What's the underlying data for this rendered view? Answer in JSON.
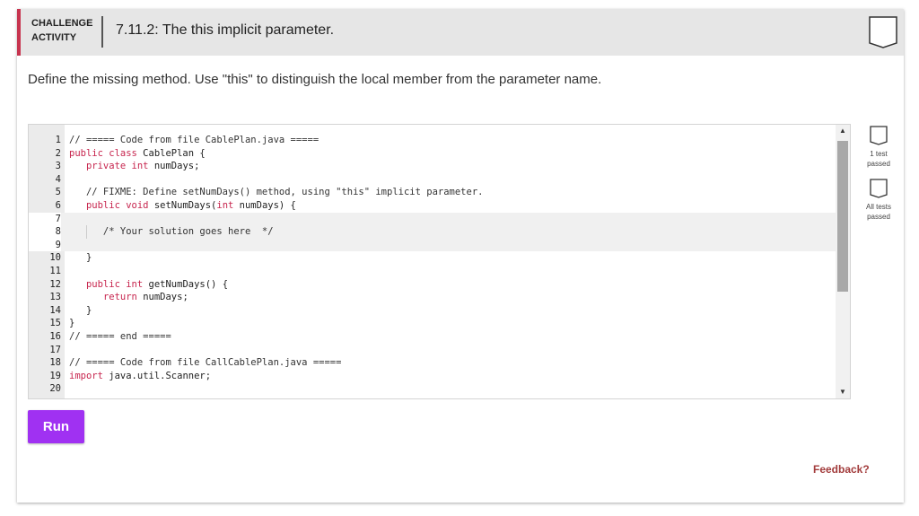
{
  "header": {
    "badge_line1": "CHALLENGE",
    "badge_line2": "ACTIVITY",
    "title": "7.11.2: The this implicit parameter.",
    "bookmark_icon": "bookmark-icon"
  },
  "instruction": "Define the missing method. Use \"this\" to distinguish the local member from the parameter name.",
  "editor": {
    "lines": [
      {
        "n": "1",
        "parts": [
          {
            "t": "// ===== Code from file CablePlan.java =====",
            "c": "cm"
          }
        ]
      },
      {
        "n": "2",
        "parts": [
          {
            "t": "public class",
            "c": "kw"
          },
          {
            "t": " CablePlan {",
            "c": ""
          }
        ]
      },
      {
        "n": "3",
        "parts": [
          {
            "t": "   ",
            "c": ""
          },
          {
            "t": "private int",
            "c": "kw"
          },
          {
            "t": " numDays;",
            "c": ""
          }
        ]
      },
      {
        "n": "4",
        "parts": []
      },
      {
        "n": "5",
        "parts": [
          {
            "t": "   // FIXME: Define setNumDays() method, using \"this\" implicit parameter.",
            "c": "cm"
          }
        ]
      },
      {
        "n": "6",
        "parts": [
          {
            "t": "   ",
            "c": ""
          },
          {
            "t": "public void",
            "c": "kw"
          },
          {
            "t": " setNumDays(",
            "c": ""
          },
          {
            "t": "int",
            "c": "kw"
          },
          {
            "t": " numDays) {",
            "c": ""
          }
        ]
      },
      {
        "n": "7",
        "parts": []
      },
      {
        "n": "8",
        "parts": [
          {
            "t": "      /* Your solution goes here  */",
            "c": "cm"
          }
        ]
      },
      {
        "n": "9",
        "parts": []
      },
      {
        "n": "10",
        "parts": [
          {
            "t": "   }",
            "c": ""
          }
        ]
      },
      {
        "n": "11",
        "parts": []
      },
      {
        "n": "12",
        "parts": [
          {
            "t": "   ",
            "c": ""
          },
          {
            "t": "public int",
            "c": "kw"
          },
          {
            "t": " getNumDays() {",
            "c": ""
          }
        ]
      },
      {
        "n": "13",
        "parts": [
          {
            "t": "      ",
            "c": ""
          },
          {
            "t": "return",
            "c": "kw"
          },
          {
            "t": " numDays;",
            "c": ""
          }
        ]
      },
      {
        "n": "14",
        "parts": [
          {
            "t": "   }",
            "c": ""
          }
        ]
      },
      {
        "n": "15",
        "parts": [
          {
            "t": "}",
            "c": ""
          }
        ]
      },
      {
        "n": "16",
        "parts": [
          {
            "t": "// ===== end =====",
            "c": "cm"
          }
        ]
      },
      {
        "n": "17",
        "parts": []
      },
      {
        "n": "18",
        "parts": [
          {
            "t": "// ===== Code from file CallCablePlan.java =====",
            "c": "cm"
          }
        ]
      },
      {
        "n": "19",
        "parts": [
          {
            "t": "import",
            "c": "kw"
          },
          {
            "t": " java.util.Scanner;",
            "c": ""
          }
        ]
      },
      {
        "n": "20",
        "parts": []
      }
    ],
    "active_lines": [
      "7",
      "8",
      "9"
    ]
  },
  "tests": [
    {
      "label_line1": "1 test",
      "label_line2": "passed"
    },
    {
      "label_line1": "All tests",
      "label_line2": "passed"
    }
  ],
  "run_label": "Run",
  "feedback_label": "Feedback?",
  "colors": {
    "accent_bar": "#c7344f",
    "run_button": "#a031f2",
    "keyword": "#c7254e",
    "feedback": "#a23b3b"
  }
}
